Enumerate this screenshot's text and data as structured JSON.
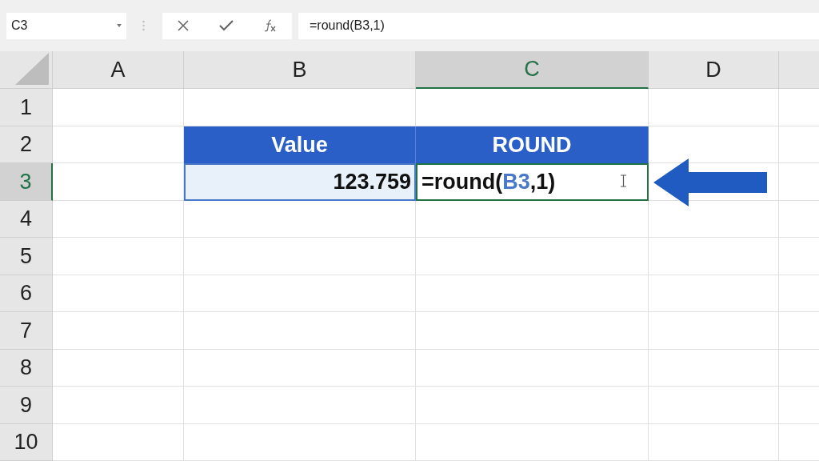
{
  "name_box": {
    "value": "C3"
  },
  "formula_bar": {
    "value": "=round(B3,1)"
  },
  "columns": [
    {
      "label": "A",
      "selected": false
    },
    {
      "label": "B",
      "selected": false
    },
    {
      "label": "C",
      "selected": true
    },
    {
      "label": "D",
      "selected": false
    }
  ],
  "rows": [
    {
      "label": "1",
      "selected": false
    },
    {
      "label": "2",
      "selected": false,
      "cells": [
        {
          "kind": "blank"
        },
        {
          "kind": "header",
          "text": "Value"
        },
        {
          "kind": "header",
          "text": "ROUND"
        },
        {
          "kind": "blank"
        }
      ]
    },
    {
      "label": "3",
      "selected": true,
      "cells": [
        {
          "kind": "blank"
        },
        {
          "kind": "reference",
          "text": "123.759"
        },
        {
          "kind": "formula",
          "selected": true,
          "parts": [
            {
              "kind": "plain",
              "text": "=round("
            },
            {
              "kind": "ref",
              "text": "B3"
            },
            {
              "kind": "plain",
              "text": ",1)"
            }
          ]
        },
        {
          "kind": "blank"
        }
      ]
    },
    {
      "label": "4",
      "selected": false
    },
    {
      "label": "5",
      "selected": false
    },
    {
      "label": "6",
      "selected": false
    },
    {
      "label": "7",
      "selected": false
    },
    {
      "label": "8",
      "selected": false
    },
    {
      "label": "9",
      "selected": false
    },
    {
      "label": "10",
      "selected": false
    }
  ]
}
